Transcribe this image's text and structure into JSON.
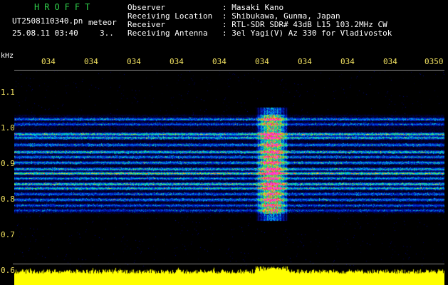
{
  "header": {
    "logo": "HROFFT",
    "filename": "UT2508110340.pn",
    "tag": "meteor",
    "datetime": "25.08.11 03:40",
    "count": "3..",
    "fields": [
      {
        "label": "Observer",
        "value": ": Masaki Kano"
      },
      {
        "label": "Receiving Location",
        "value": ": Shibukawa, Gunma, Japan"
      },
      {
        "label": "Receiver",
        "value": ": RTL-SDR SDR# 43dB L15 103.2MHz CW"
      },
      {
        "label": "Receiving Antenna",
        "value": ": 3el Yagi(V) Az 330 for Vladivostok"
      }
    ]
  },
  "axis": {
    "unit": "kHz",
    "time_ticks": [
      "034",
      "034",
      "034",
      "034",
      "034",
      "034",
      "034",
      "034",
      "034",
      "0350"
    ],
    "freq_ticks": [
      "1.1",
      "1.0",
      "0.9",
      "0.8",
      "0.7",
      "0.6"
    ]
  },
  "colors": {
    "background": "#000000",
    "logo": "#2fd04a",
    "tick_labels": "#f0e060",
    "level_trace": "#ffff00"
  }
}
